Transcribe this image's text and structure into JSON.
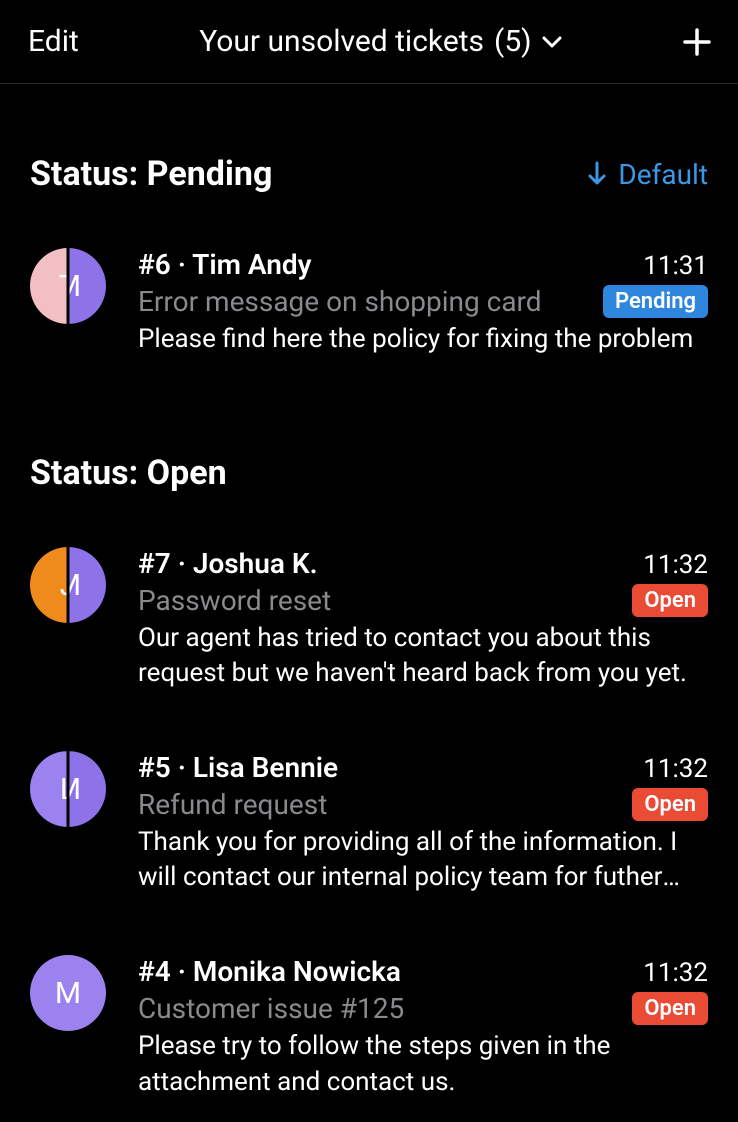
{
  "header": {
    "edit": "Edit",
    "title": "Your unsolved tickets",
    "count": "(5)"
  },
  "sort": {
    "label": "Default"
  },
  "sections": [
    {
      "title": "Status: Pending",
      "tickets": [
        {
          "id": "#6",
          "sep": " · ",
          "name": "Tim Andy",
          "time": "11:31",
          "subject": "Error message on shopping card",
          "status": "Pending",
          "status_color": "#2f86de",
          "preview": "Please find here the policy for fixing the problem",
          "avatar_left": {
            "letter": "T",
            "color": "#f2c0c4"
          },
          "avatar_right": {
            "letter": "M",
            "color": "#8d72e8"
          }
        }
      ]
    },
    {
      "title": "Status: Open",
      "tickets": [
        {
          "id": "#7",
          "sep": " · ",
          "name": "Joshua K.",
          "time": "11:32",
          "subject": "Password reset",
          "status": "Open",
          "status_color": "#e94b35",
          "preview": "Our agent has tried to contact you about this request but we haven't heard back from you yet.",
          "avatar_left": {
            "letter": "J",
            "color": "#ee8b1c"
          },
          "avatar_right": {
            "letter": "M",
            "color": "#8d72e8"
          }
        },
        {
          "id": "#5",
          "sep": " · ",
          "name": "Lisa Bennie",
          "time": "11:32",
          "subject": "Refund request",
          "status": "Open",
          "status_color": "#e94b35",
          "preview": "Thank you for providing all of the information. I will contact our internal policy team for futher assistance with your request.",
          "avatar_left": {
            "letter": "L",
            "color": "#9c82ef"
          },
          "avatar_right": {
            "letter": "M",
            "color": "#8d72e8"
          }
        },
        {
          "id": "#4",
          "sep": " · ",
          "name": "Monika Nowicka",
          "time": "11:32",
          "subject": "Customer issue #125",
          "status": "Open",
          "status_color": "#e94b35",
          "preview": "Please try to follow the steps given in the attachment and contact us.",
          "avatar_left": {
            "letter": "M",
            "color": "#9c82ef"
          },
          "avatar_right": null
        }
      ]
    }
  ]
}
